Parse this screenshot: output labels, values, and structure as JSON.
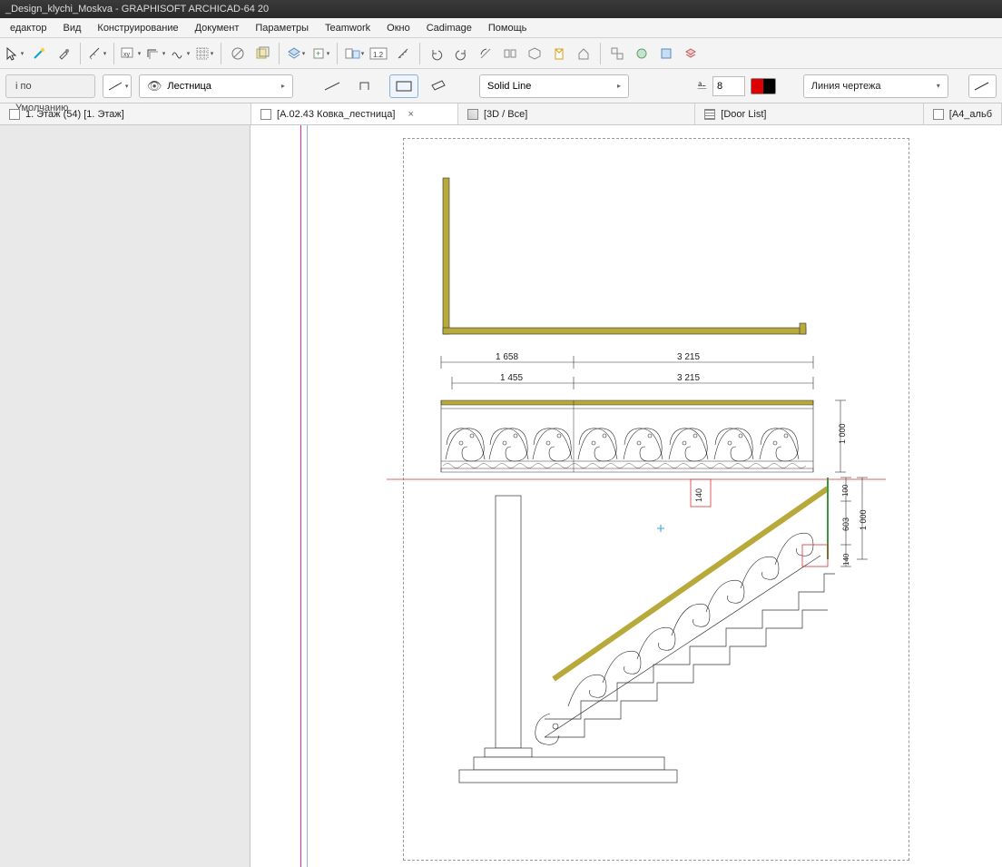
{
  "title": "_Design_klychi_Moskva - GRAPHISOFT ARCHICAD-64 20",
  "menu": {
    "editor": "едактор",
    "view": "Вид",
    "construct": "Конструирование",
    "document": "Документ",
    "params": "Параметры",
    "teamwork": "Teamwork",
    "window": "Окно",
    "cadimage": "Cadimage",
    "help": "Помощь"
  },
  "info": {
    "default": "і по Умолчанию",
    "layer": "Лестница",
    "linetype": "Solid Line",
    "pen_value": "8",
    "linecat": "Линия чертежа"
  },
  "tabs": {
    "t1": "1. Этаж (54) [1. Этаж]",
    "t2": "[A.02.43 Ковка_лестница]",
    "t3": "[3D / Все]",
    "t4": "[Door List]",
    "t5": "[A4_альб"
  },
  "dims": {
    "a": "1 658",
    "b": "3 215",
    "c": "1 455",
    "d": "3 215",
    "h1": "1 000",
    "h2": "1 000",
    "h3": "140",
    "h4": "140",
    "h5": "603",
    "h6": "100"
  }
}
